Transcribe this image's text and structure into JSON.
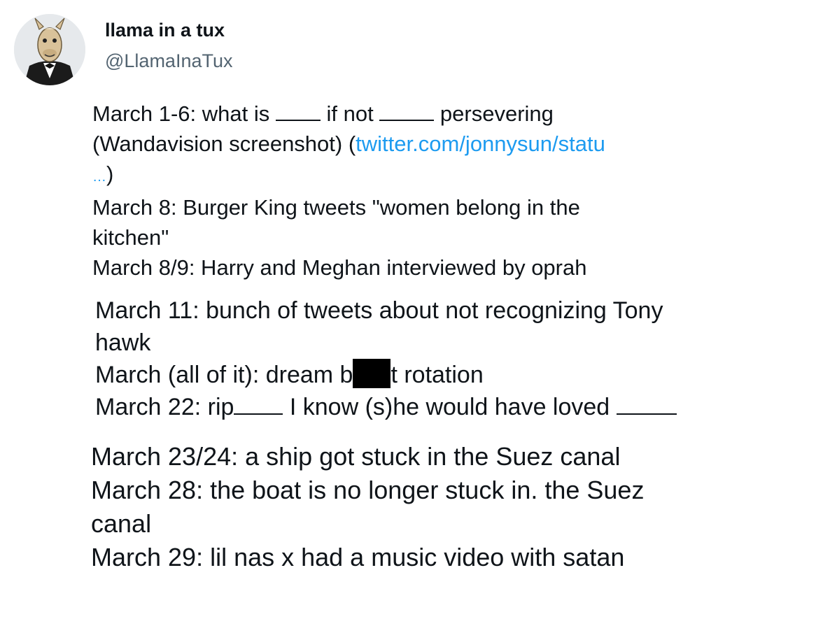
{
  "tweet": {
    "author_name": "llama in a tux",
    "author_handle": "@LlamaInaTux",
    "avatar_icon": "llama-in-tuxedo-avatar",
    "link_color": "#1d9bf0",
    "block1": {
      "l1_a": "March 1-6: what is ",
      "l1_b": " if not ",
      "l1_c": " persevering",
      "l2_a": "(Wandavision screenshot) (",
      "l2_link": "twitter.com/jonnysun/statu",
      "l3_ell": "…",
      "l3_close": ")",
      "l4": "March 8: Burger King tweets \"women belong in the",
      "l5": "kitchen\"",
      "l6": "March 8/9: Harry and Meghan interviewed by oprah"
    },
    "block2": {
      "l1": "March 11: bunch of tweets about not recognizing Tony",
      "l2": "hawk",
      "l3_a": "March (all of it): dream b",
      "l3_b": "t rotation",
      "l4_a": "March 22: rip",
      "l4_b": " I know (s)he would have loved "
    },
    "block3": {
      "l1": "March 23/24: a ship got stuck in the Suez canal",
      "l2": "March 28: the boat is no longer stuck in. the Suez",
      "l3": "canal",
      "l4": "March 29: lil nas x had a music video with satan"
    }
  }
}
